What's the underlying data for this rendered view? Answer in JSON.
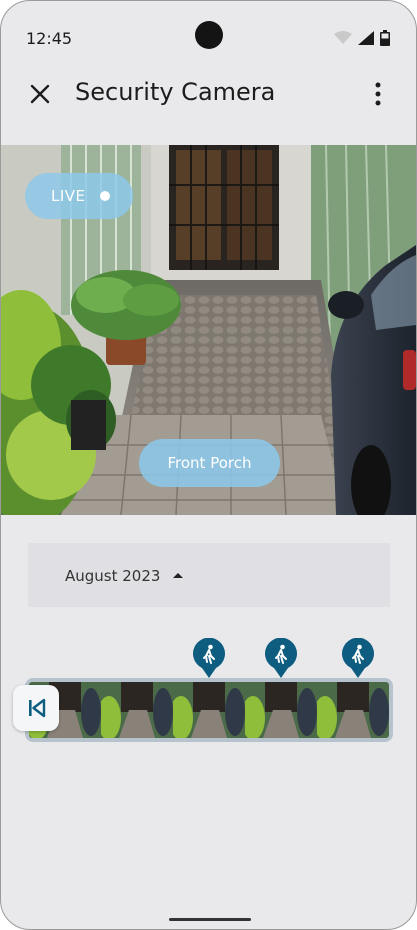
{
  "status_bar": {
    "time": "12:45"
  },
  "app_bar": {
    "title": "Security Camera"
  },
  "video": {
    "live_label": "LIVE",
    "camera_name": "Front Porch"
  },
  "timeline": {
    "month_label": "August 2023",
    "event_markers": [
      "person-walking-icon",
      "person-walking-icon",
      "person-walking-icon"
    ]
  },
  "colors": {
    "live_pill": "#8cc8eb",
    "marker": "#0e5d80",
    "background": "#e9e9ec"
  }
}
